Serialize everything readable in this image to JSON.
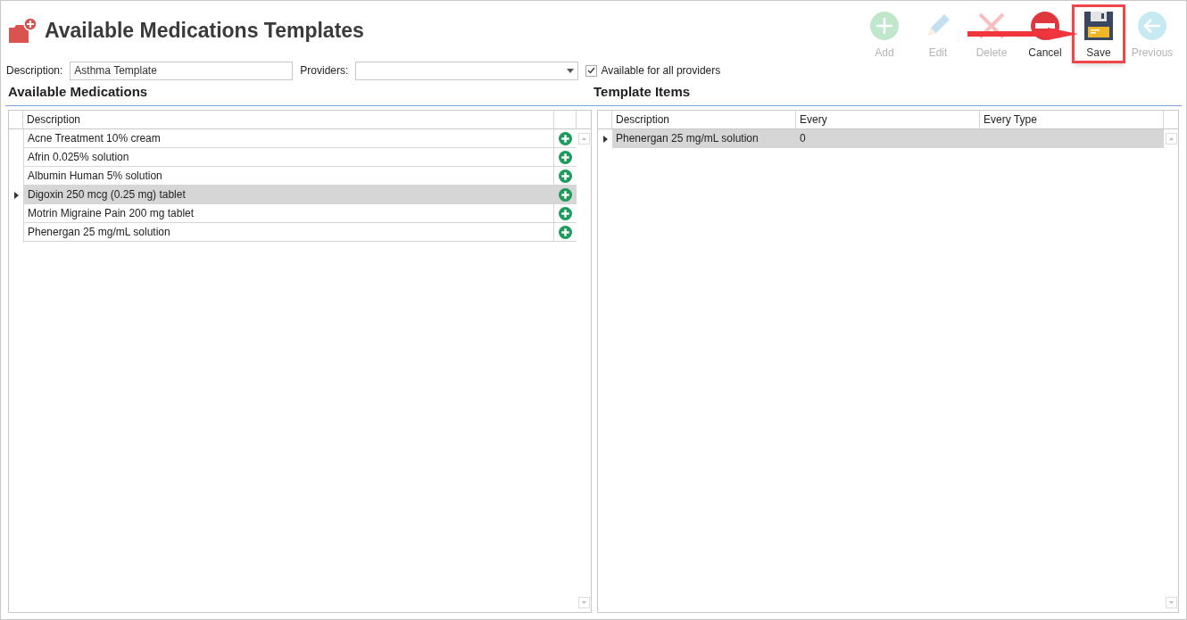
{
  "title": "Available Medications Templates",
  "toolbar": [
    {
      "kind": "add",
      "label": "Add",
      "disabled": true,
      "highlighted": false
    },
    {
      "kind": "edit",
      "label": "Edit",
      "disabled": true,
      "highlighted": false
    },
    {
      "kind": "delete",
      "label": "Delete",
      "disabled": true,
      "highlighted": false
    },
    {
      "kind": "cancel",
      "label": "Cancel",
      "disabled": false,
      "highlighted": false
    },
    {
      "kind": "save",
      "label": "Save",
      "disabled": false,
      "highlighted": true
    },
    {
      "kind": "previous",
      "label": "Previous",
      "disabled": true,
      "highlighted": false
    }
  ],
  "form": {
    "description_label": "Description:",
    "description_value": "Asthma Template",
    "providers_label": "Providers:",
    "all_providers": {
      "label": "Available for all providers",
      "checked": true
    }
  },
  "available": {
    "heading": "Available Medications",
    "columns": [
      "Description"
    ],
    "rows": [
      {
        "description": "Acne Treatment 10% cream",
        "selected": false
      },
      {
        "description": "Afrin 0.025% solution",
        "selected": false
      },
      {
        "description": "Albumin Human 5% solution",
        "selected": false
      },
      {
        "description": "Digoxin 250 mcg (0.25 mg) tablet",
        "selected": true
      },
      {
        "description": "Motrin Migraine Pain 200 mg tablet",
        "selected": false
      },
      {
        "description": "Phenergan 25 mg/mL solution",
        "selected": false
      }
    ]
  },
  "template": {
    "heading": "Template Items",
    "columns": [
      "Description",
      "Every",
      "Every Type"
    ],
    "rows": [
      {
        "description": "Phenergan 25 mg/mL solution",
        "every": "0",
        "selected": true
      }
    ]
  }
}
